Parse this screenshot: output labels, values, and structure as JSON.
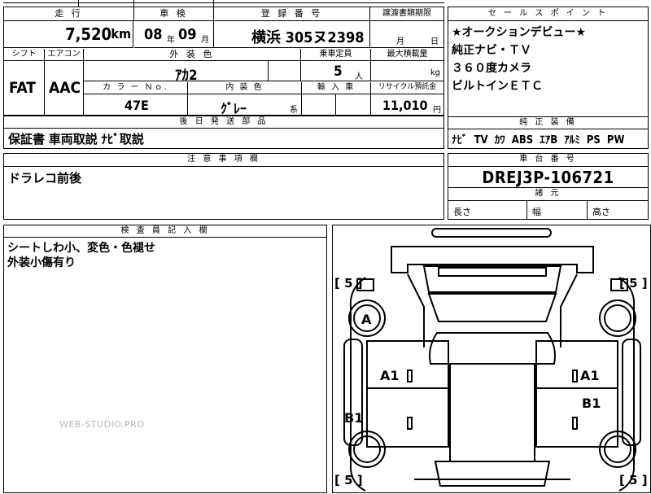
{
  "top_left": {
    "mileage_label": "走 行",
    "mileage_value": "7,520",
    "mileage_unit": "km",
    "inspection_label": "車 検",
    "inspection_year": "08",
    "inspection_year_unit": "年",
    "inspection_month": "09",
    "inspection_month_unit": "月",
    "registration_label": "登 録 番 号",
    "registration_value": "横浜 305ヌ2398",
    "transfer_label": "譲渡書類期限",
    "transfer_month_unit": "月",
    "transfer_day_unit": "日"
  },
  "row2": {
    "shift_label": "シフト",
    "shift_value": "FAT",
    "aircon_label": "エアコン",
    "aircon_value": "AAC",
    "exterior_label": "外 装 色",
    "exterior_value": "ｱｶ2",
    "capacity_label": "乗車定員",
    "capacity_value": "5",
    "capacity_unit": "人",
    "maxload_label": "最大積載量",
    "maxload_unit": "kg",
    "colorno_label": "カ ラ ー Ｎｏ.",
    "colorno_value": "47E",
    "interior_label": "内 装 色",
    "interior_value": "ｸﾞﾚｰ",
    "interior_unit": "系",
    "import_label": "輸 入 車",
    "recycle_label": "リサイクル預託金",
    "recycle_value": "11,010",
    "recycle_unit": "円"
  },
  "later_parts": {
    "label": "後 日 発 送 部 品",
    "value": "保証書 車両取説 ﾅﾋﾞ取説"
  },
  "notes": {
    "label": "注 意 事 項 欄",
    "value": "ドラレコ前後"
  },
  "inspector": {
    "label": "検 査 員 記 入 欄",
    "lines": [
      "シートしわ小、変色・色褪せ",
      "外装小傷有り"
    ]
  },
  "sales_points": {
    "label": "セ ー ル ス ポ イ ン ト",
    "lines": [
      "★オークションデビュー★",
      "純正ナビ・ＴＶ",
      "３６０度カメラ",
      "ビルトインＥＴＣ"
    ]
  },
  "genuine_equipment": {
    "label": "純 正 装 備",
    "items": [
      "ﾅﾋﾞ",
      "TV",
      "ｶﾜ",
      "ABS",
      "ｴｱB",
      "ｱﾙﾐ",
      "PS",
      "PW"
    ]
  },
  "chassis": {
    "label": "車 台 番 号",
    "value": "DREJ3P-106721"
  },
  "dimensions": {
    "label": "諸 元",
    "length_label": "長さ",
    "width_label": "幅",
    "height_label": "高さ"
  },
  "diagram": {
    "marks": {
      "front_left": "A",
      "left_front_door": "A1",
      "right_front_door": "A1",
      "right_rear_door": "B1",
      "left_rear": "B1"
    },
    "tire_labels": [
      "[ 5 ]",
      "[ 5 ]",
      "[ 5 ]",
      "[ 5 ]"
    ]
  },
  "watermark": "WEB-STUDIO.PRO"
}
